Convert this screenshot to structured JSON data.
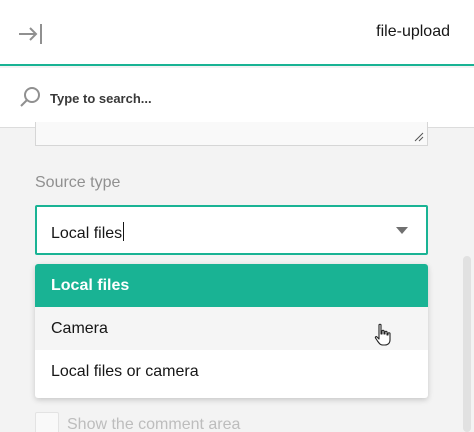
{
  "header": {
    "title": "file-upload",
    "collapse_icon": "collapse-panel-icon"
  },
  "search": {
    "placeholder": "Type to search...",
    "icon": "search-icon"
  },
  "question": {
    "label": "Source type",
    "selected_value": "Local files",
    "options": [
      {
        "label": "Local files",
        "state": "selected"
      },
      {
        "label": "Camera",
        "state": "hover"
      },
      {
        "label": "Local files or camera",
        "state": "normal"
      }
    ]
  },
  "checkbox": {
    "label": "Show the comment area"
  },
  "colors": {
    "accent": "#19b394",
    "label_gray": "#909090"
  }
}
